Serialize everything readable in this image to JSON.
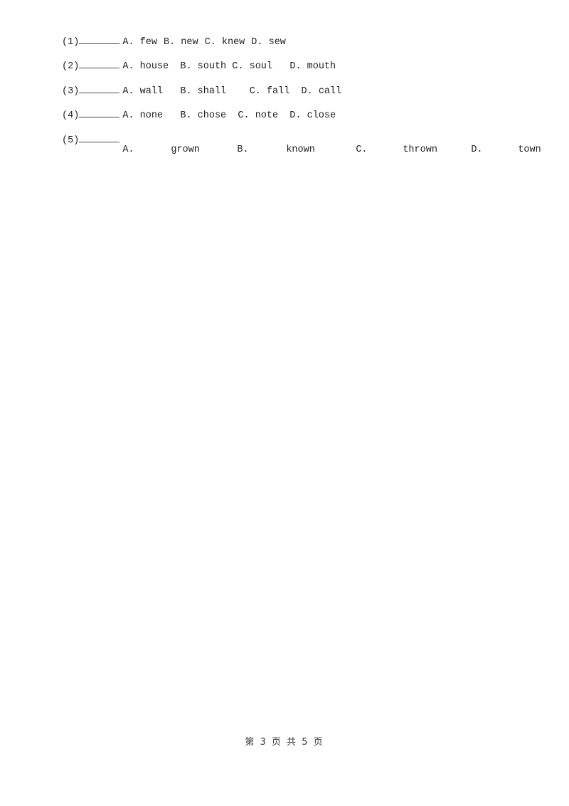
{
  "document": {
    "page_label": "第 3 页 共 5 页",
    "background_color": "#ffffff",
    "text_color": "#222222"
  },
  "questions": [
    {
      "number": "(1)",
      "blank": "________",
      "options": [
        {
          "letter": "A.",
          "word": "few"
        },
        {
          "letter": "B.",
          "word": "new"
        },
        {
          "letter": "C.",
          "word": "knew"
        },
        {
          "letter": "D.",
          "word": "sew"
        }
      ]
    },
    {
      "number": "(2)",
      "blank": "________",
      "options": [
        {
          "letter": "A.",
          "word": "house"
        },
        {
          "letter": "B.",
          "word": "south"
        },
        {
          "letter": "C.",
          "word": "soul"
        },
        {
          "letter": "D.",
          "word": "mouth"
        }
      ]
    },
    {
      "number": "(3)",
      "blank": "________",
      "options": [
        {
          "letter": "A.",
          "word": "wall"
        },
        {
          "letter": "B.",
          "word": "shall"
        },
        {
          "letter": "C.",
          "word": "fall"
        },
        {
          "letter": "D.",
          "word": "call"
        }
      ]
    },
    {
      "number": "(4)",
      "blank": "________",
      "options": [
        {
          "letter": "A.",
          "word": "none"
        },
        {
          "letter": "B.",
          "word": "chose"
        },
        {
          "letter": "C.",
          "word": "note"
        },
        {
          "letter": "D.",
          "word": "close"
        }
      ]
    },
    {
      "number": "(5)",
      "blank": "________",
      "options": [
        {
          "letter": "A.",
          "word": "grown"
        },
        {
          "letter": "B.",
          "word": "known"
        },
        {
          "letter": "C.",
          "word": "thrown"
        },
        {
          "letter": "D.",
          "word": "town"
        }
      ]
    }
  ]
}
